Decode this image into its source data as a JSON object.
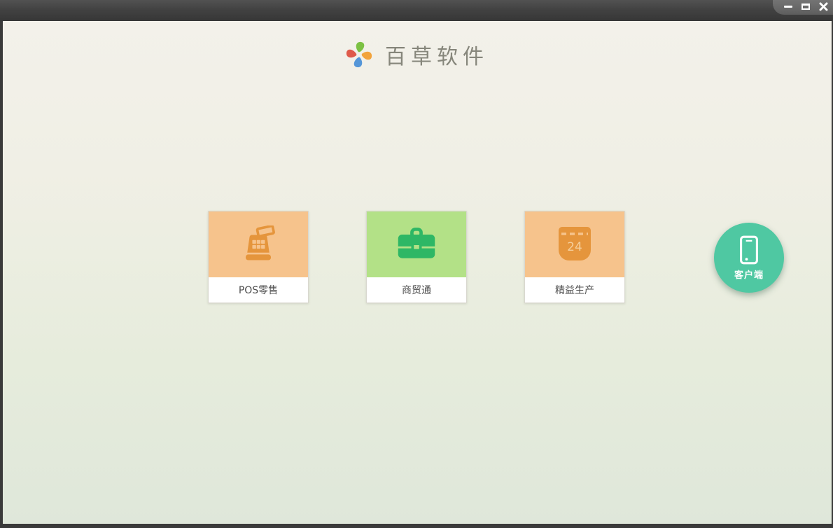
{
  "window": {
    "controls": [
      {
        "name": "minimize"
      },
      {
        "name": "maximize"
      },
      {
        "name": "close"
      }
    ]
  },
  "brand": {
    "logo_icon": "pinwheel-logo",
    "title": "百草软件"
  },
  "products": [
    {
      "label": "POS零售",
      "icon": "cash-register-icon",
      "card_bg": "#f6c38c",
      "icon_color": "#e5953c"
    },
    {
      "label": "商贸通",
      "icon": "briefcase-icon",
      "card_bg": "#b3e187",
      "icon_color": "#2eb765"
    },
    {
      "label": "精益生产",
      "icon": "calendar-icon",
      "calendar_day": "24",
      "card_bg": "#f6c38c",
      "icon_color": "#e5953c"
    }
  ],
  "client_button": {
    "label": "客户端",
    "icon": "smartphone-icon",
    "color": "#4fc8a2"
  }
}
